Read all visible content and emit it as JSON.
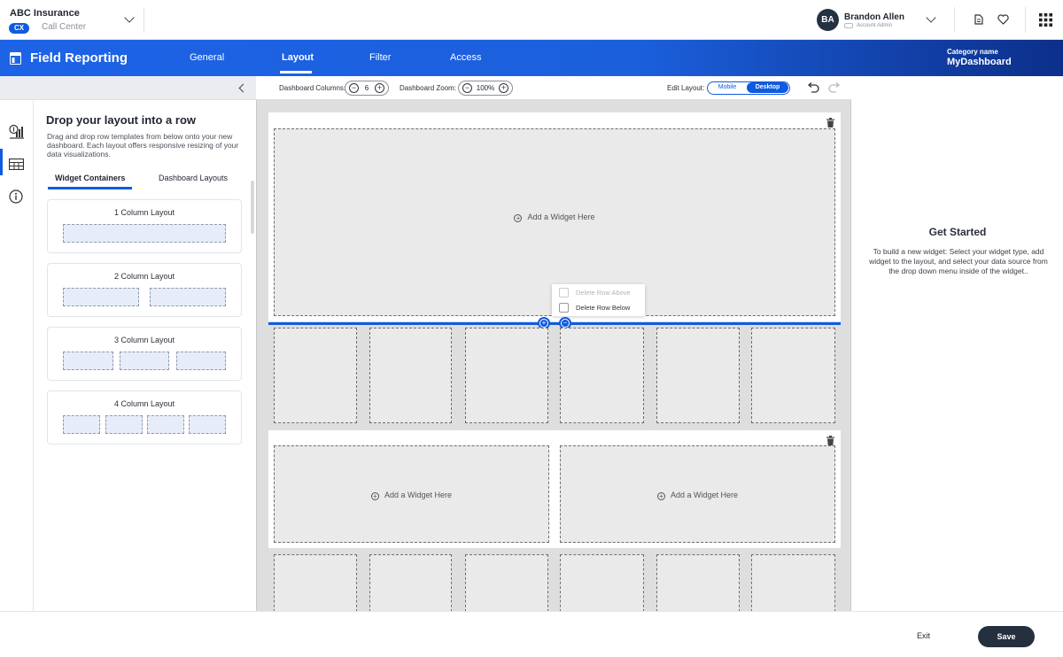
{
  "header": {
    "org_name": "ABC Insurance",
    "org_badge": "CX",
    "org_sub": "Call Center",
    "user_initials": "BA",
    "user_name": "Brandon Allen",
    "user_role": "Account Admin"
  },
  "nav": {
    "app_title": "Field Reporting",
    "tabs": [
      {
        "label": "General"
      },
      {
        "label": "Layout"
      },
      {
        "label": "Filter"
      },
      {
        "label": "Access"
      }
    ],
    "active_tab": "Layout",
    "category_label": "Category name",
    "category_value": "MyDashboard"
  },
  "left_panel": {
    "title": "Drop your layout into a row",
    "description": "Drag and drop row templates from below onto your new dashboard. Each layout offers responsive resizing of your data visualizations.",
    "tabs": [
      {
        "label": "Widget Containers"
      },
      {
        "label": "Dashboard Layouts"
      }
    ],
    "cards": [
      {
        "title": "1 Column Layout",
        "columns": 1
      },
      {
        "title": "2 Column Layout",
        "columns": 2
      },
      {
        "title": "3 Column Layout",
        "columns": 3
      },
      {
        "title": "4 Column Layout",
        "columns": 4
      }
    ]
  },
  "toolbar": {
    "columns_label": "Dashboard Columns:",
    "columns_value": "6",
    "zoom_label": "Dashboard Zoom:",
    "zoom_value": "100%",
    "edit_layout_label": "Edit Layout:",
    "mode_mobile": "Mobile",
    "mode_desktop": "Desktop",
    "active_mode": "Desktop"
  },
  "canvas": {
    "add_widget_label": "Add a Widget Here",
    "context_menu": {
      "delete_above": "Delete Row Above",
      "delete_below": "Delete Row Below"
    }
  },
  "right_panel": {
    "title": "Get Started",
    "text": "To build a new widget: Select your widget type, add widget to the layout, and select your data source from the drop down menu inside of the widget.."
  },
  "footer": {
    "exit_label": "Exit",
    "save_label": "Save"
  },
  "colors": {
    "accent": "#0f5be0",
    "nav_dark": "#0c2f8a",
    "save_button": "#25303e"
  }
}
